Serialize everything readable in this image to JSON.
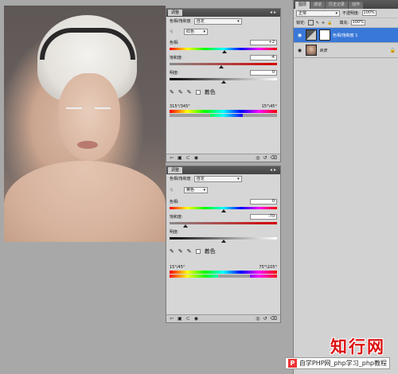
{
  "panels": [
    {
      "tab_label": "调整",
      "title": "色相/饱和度",
      "preset": "自定",
      "channel": "红色",
      "hue_label": "色相:",
      "hue_value": "+2",
      "hue_pos": 0.51,
      "sat_label": "饱和度:",
      "sat_value": "-4",
      "sat_pos": 0.48,
      "light_label": "明度:",
      "light_value": "0",
      "light_pos": 0.5,
      "colorize_label": "着色",
      "range_left": "315°/345°",
      "range_right": "15°\\45°"
    },
    {
      "tab_label": "调整",
      "title": "色相/饱和度",
      "preset": "自定",
      "channel": "黄色",
      "hue_label": "色相:",
      "hue_value": "0",
      "hue_pos": 0.5,
      "sat_label": "饱和度:",
      "sat_value": "-70",
      "sat_pos": 0.15,
      "light_label": "明度:",
      "light_value": "0",
      "light_pos": 0.5,
      "colorize_label": "着色",
      "range_left": "15°/45°",
      "range_right": "75°\\105°"
    }
  ],
  "layers": {
    "tabs": [
      "图层",
      "通道",
      "历史记录",
      "动作"
    ],
    "active_tab": "图层",
    "blend_mode": "正常",
    "opacity_label": "不透明度:",
    "opacity": "100%",
    "lock_label": "锁定:",
    "fill_label": "填充:",
    "fill": "100%",
    "items": [
      {
        "name": "色相/饱和度 1",
        "selected": true
      },
      {
        "name": "背景",
        "selected": false
      }
    ]
  },
  "watermark": {
    "logo_text": "知行网",
    "p_mark": "P",
    "site_text": "自学PHP网_php学习_php教程"
  }
}
